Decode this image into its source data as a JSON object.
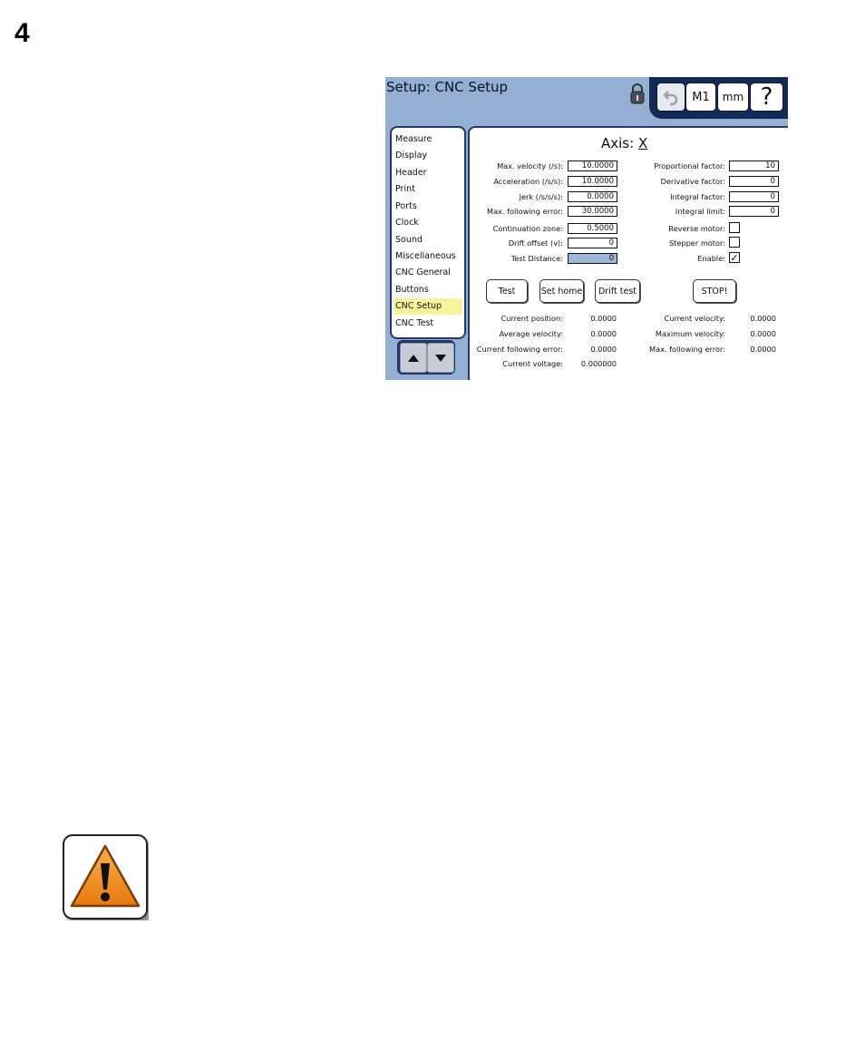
{
  "page": {
    "number": "4"
  },
  "screen": {
    "title": "Setup: CNC Setup",
    "toolbar": {
      "m1_label": "M1",
      "units_label": "mm",
      "help_label": "?"
    },
    "menu": {
      "items": [
        "Measure",
        "Display",
        "Header",
        "Print",
        "Ports",
        "Clock",
        "Sound",
        "Miscellaneous",
        "CNC General",
        "Buttons",
        "CNC Setup",
        "CNC Test"
      ],
      "selected": "CNC Setup"
    },
    "axis": {
      "label": "Axis:",
      "value": "X"
    },
    "left_params": [
      {
        "label": "Max. velocity (/s):",
        "value": "10.0000"
      },
      {
        "label": "Acceleration (/s/s):",
        "value": "10.0000"
      },
      {
        "label": "Jerk (/s/s/s):",
        "value": "0.0000"
      },
      {
        "label": "Max. following error:",
        "value": "30.0000"
      },
      {
        "label": "Continuation zone:",
        "value": "0.5000"
      },
      {
        "label": "Drift offset (v):",
        "value": "0"
      },
      {
        "label": "Test Distance:",
        "value": "0"
      }
    ],
    "right_params": [
      {
        "label": "Proportional factor:",
        "value": "10"
      },
      {
        "label": "Derivative factor:",
        "value": "0"
      },
      {
        "label": "Integral factor:",
        "value": "0"
      },
      {
        "label": "Integral limit:",
        "value": "0"
      }
    ],
    "checkboxes": [
      {
        "label": "Reverse motor:",
        "checked": false
      },
      {
        "label": "Stepper motor:",
        "checked": false
      },
      {
        "label": "Enable:",
        "checked": true,
        "mark": "✓"
      }
    ],
    "buttons": {
      "test": "Test",
      "set_home": "Set home",
      "drift_test": "Drift test",
      "stop": "STOP!"
    },
    "readouts_left": [
      {
        "label": "Current position:",
        "value": "0.0000"
      },
      {
        "label": "Average velocity:",
        "value": "0.0000"
      },
      {
        "label": "Current following error:",
        "value": "0.0000"
      },
      {
        "label": "Current voltage:",
        "value": "0.000000"
      }
    ],
    "readouts_right": [
      {
        "label": "Current velocity:",
        "value": "0.0000"
      },
      {
        "label": "Maximum velocity:",
        "value": "0.0000"
      },
      {
        "label": "Max. following error:",
        "value": "0.0000"
      }
    ]
  },
  "warning": {
    "icon": "warning-icon",
    "color": "#f0931e"
  }
}
